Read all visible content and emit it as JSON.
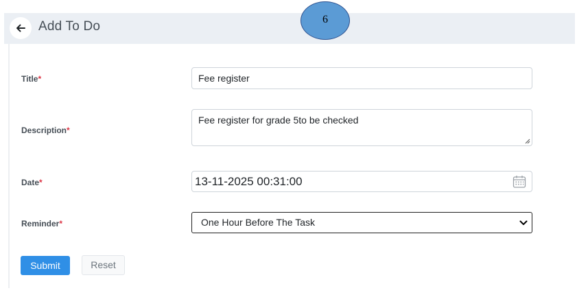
{
  "header": {
    "title": "Add To Do",
    "back_icon": "arrow-left-icon"
  },
  "step_badge": "6",
  "form": {
    "title": {
      "label": "Title",
      "required_mark": "*",
      "value": "Fee register"
    },
    "description": {
      "label": "Description",
      "required_mark": "*",
      "value": "Fee register for grade 5to be checked"
    },
    "date": {
      "label": "Date",
      "required_mark": "*",
      "value": "13-11-2025 00:31:00",
      "icon": "calendar-icon"
    },
    "reminder": {
      "label": "Reminder",
      "required_mark": "*",
      "value": "One Hour Before The Task",
      "icon": "chevron-down-icon"
    }
  },
  "buttons": {
    "submit": "Submit",
    "reset": "Reset"
  },
  "colors": {
    "header_bg": "#ebeff4",
    "primary": "#2f8fe6",
    "required": "#dc3545",
    "badge_fill": "#5b9bd5",
    "badge_border": "#2f528f"
  }
}
